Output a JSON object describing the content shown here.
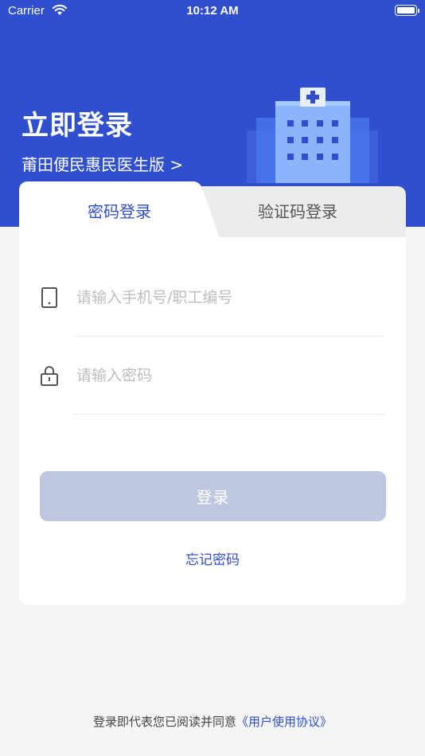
{
  "status_bar": {
    "carrier": "Carrier",
    "time": "10:12 AM",
    "battery_level": 1.0
  },
  "header": {
    "title": "立即登录",
    "subtitle": "莆田便民惠民医生版 >",
    "illustration": "hospital-building-icon"
  },
  "tabs": [
    {
      "label": "密码登录",
      "active": true
    },
    {
      "label": "验证码登录",
      "active": false
    }
  ],
  "form": {
    "phone": {
      "placeholder": "请输入手机号/职工编号",
      "value": "",
      "icon": "phone-icon"
    },
    "password": {
      "placeholder": "请输入密码",
      "value": "",
      "icon": "lock-icon"
    },
    "login_label": "登录",
    "forgot_label": "忘记密码"
  },
  "footer": {
    "agreement_text": "登录即代表您已阅读并同意",
    "agreement_link": "《用户使用协议》"
  },
  "colors": {
    "primary": "#2f4fcf",
    "button_disabled": "#bfc7e0",
    "background": "#f5f5f5"
  }
}
